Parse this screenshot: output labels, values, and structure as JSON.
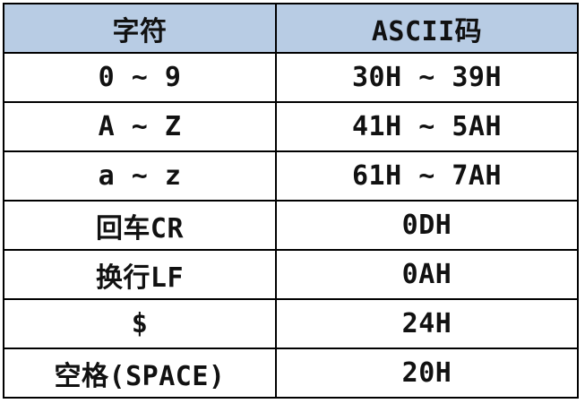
{
  "headers": {
    "char": "字符",
    "ascii": "ASCII码"
  },
  "rows": [
    {
      "char": "0 ~ 9",
      "ascii": "30H ~ 39H"
    },
    {
      "char": "A ~ Z",
      "ascii": "41H ~ 5AH"
    },
    {
      "char": "a ~ z",
      "ascii": "61H ~ 7AH"
    },
    {
      "char": "回车CR",
      "ascii": "0DH"
    },
    {
      "char": "换行LF",
      "ascii": "0AH"
    },
    {
      "char": "$",
      "ascii": "24H"
    },
    {
      "char": "空格(SPACE)",
      "ascii": "20H"
    }
  ],
  "colors": {
    "header_bg": "#b8cce4",
    "border": "#000000"
  }
}
